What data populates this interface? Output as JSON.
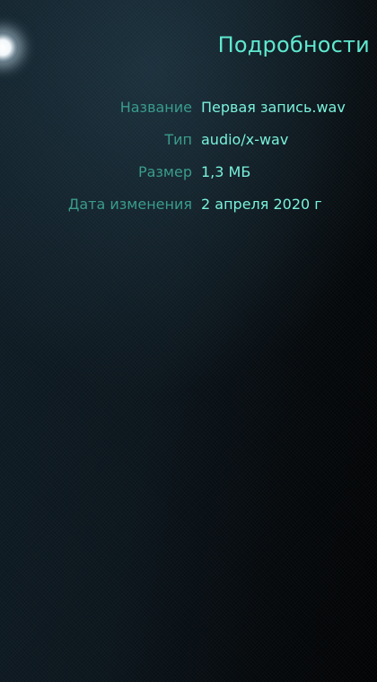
{
  "header": {
    "title": "Подробности",
    "back_icon": "pulley-glow-icon"
  },
  "details": [
    {
      "label": "Название",
      "value": "Первая запись.wav"
    },
    {
      "label": "Тип",
      "value": "audio/x-wav"
    },
    {
      "label": "Размер",
      "value": "1,3 МБ"
    },
    {
      "label": "Дата изменения",
      "value": "2 апреля 2020 г"
    }
  ],
  "colors": {
    "title": "#5fe8cf",
    "label": "#3a9c8c",
    "value": "#7af2dc",
    "background": "#0b151c"
  }
}
